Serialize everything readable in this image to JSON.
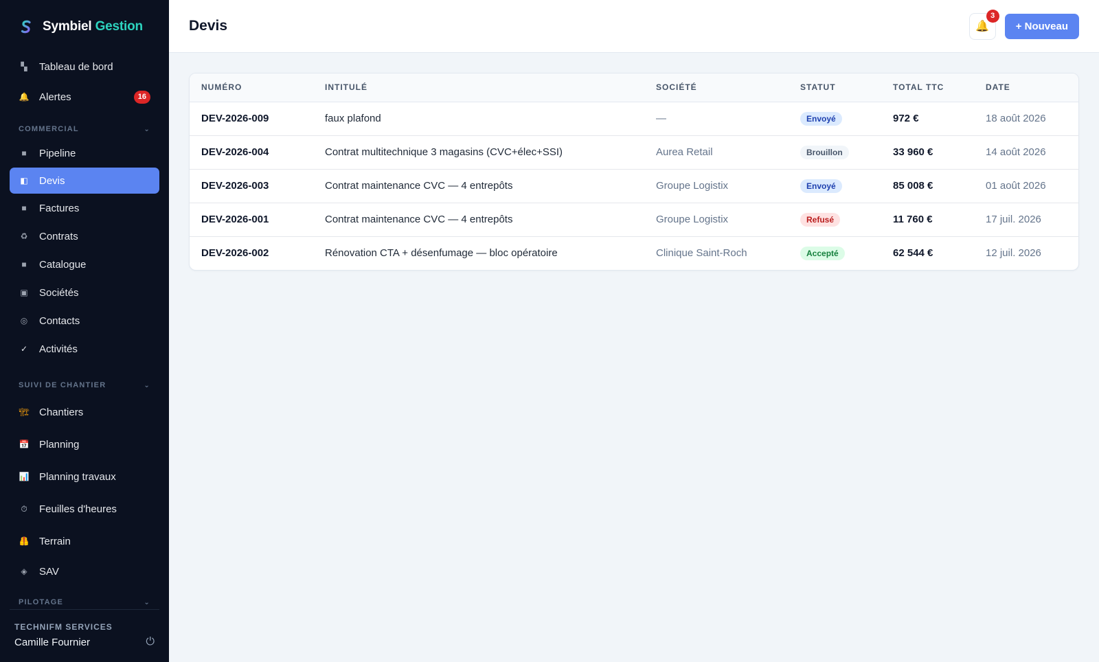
{
  "brand": {
    "name_part1": "Symbiel",
    "name_part2": "Gestion"
  },
  "nav": {
    "top": [
      {
        "label": "Tableau de bord",
        "icon": "dashboard-icon"
      },
      {
        "label": "Alertes",
        "icon": "bell-icon",
        "badge": "16"
      }
    ],
    "sections": [
      {
        "title": "COMMERCIAL",
        "items": [
          {
            "label": "Pipeline",
            "icon": "square-icon"
          },
          {
            "label": "Devis",
            "icon": "document-icon",
            "active": true
          },
          {
            "label": "Factures",
            "icon": "square-icon"
          },
          {
            "label": "Contrats",
            "icon": "recycle-icon"
          },
          {
            "label": "Catalogue",
            "icon": "square-icon"
          },
          {
            "label": "Sociétés",
            "icon": "building-icon"
          },
          {
            "label": "Contacts",
            "icon": "contact-icon"
          },
          {
            "label": "Activités",
            "icon": "check-icon"
          }
        ]
      },
      {
        "title": "SUIVI DE CHANTIER",
        "items": [
          {
            "label": "Chantiers",
            "icon": "crane-icon"
          },
          {
            "label": "Planning",
            "icon": "calendar-icon"
          },
          {
            "label": "Planning travaux",
            "icon": "chart-icon"
          },
          {
            "label": "Feuilles d'heures",
            "icon": "stopwatch-icon"
          },
          {
            "label": "Terrain",
            "icon": "vest-icon"
          },
          {
            "label": "SAV",
            "icon": "diamond-icon"
          }
        ]
      },
      {
        "title": "PILOTAGE",
        "items": []
      }
    ]
  },
  "footer": {
    "org": "TECHNIFM SERVICES",
    "user": "Camille Fournier"
  },
  "header": {
    "title": "Devis",
    "notif_count": "3",
    "new_label": "+ Nouveau"
  },
  "table": {
    "columns": [
      "NUMÉRO",
      "INTITULÉ",
      "SOCIÉTÉ",
      "STATUT",
      "TOTAL TTC",
      "DATE"
    ],
    "rows": [
      {
        "numero": "DEV-2026-009",
        "intitule": "faux plafond",
        "societe": "—",
        "statut": "Envoyé",
        "total": "972 €",
        "date": "18 août 2026"
      },
      {
        "numero": "DEV-2026-004",
        "intitule": "Contrat multitechnique 3 magasins (CVC+élec+SSI)",
        "societe": "Aurea Retail",
        "statut": "Brouillon",
        "total": "33 960 €",
        "date": "14 août 2026"
      },
      {
        "numero": "DEV-2026-003",
        "intitule": "Contrat maintenance CVC — 4 entrepôts",
        "societe": "Groupe Logistix",
        "statut": "Envoyé",
        "total": "85 008 €",
        "date": "01 août 2026"
      },
      {
        "numero": "DEV-2026-001",
        "intitule": "Contrat maintenance CVC — 4 entrepôts",
        "societe": "Groupe Logistix",
        "statut": "Refusé",
        "total": "11 760 €",
        "date": "17 juil. 2026"
      },
      {
        "numero": "DEV-2026-002",
        "intitule": "Rénovation CTA + désenfumage — bloc opératoire",
        "societe": "Clinique Saint-Roch",
        "statut": "Accepté",
        "total": "62 544 €",
        "date": "12 juil. 2026"
      }
    ]
  },
  "colors": {
    "accent": "#5b84f1",
    "sidebar_bg": "#0b1120",
    "brand_teal": "#2dd4bf",
    "danger": "#dc2626"
  }
}
